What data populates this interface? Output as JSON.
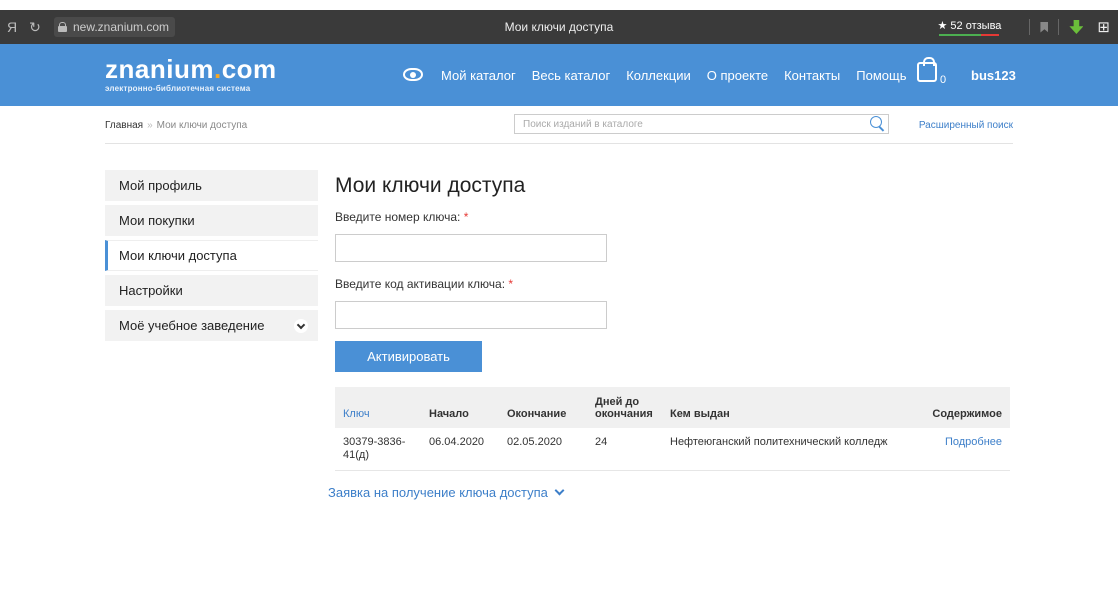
{
  "browser": {
    "yandex_glyph": "Я",
    "reload_glyph": "С",
    "url": "new.znanium.com",
    "tab_title": "Мои ключи доступа",
    "reviews_label": "★ 52 отзыва"
  },
  "header": {
    "logo_main_a": "znanium",
    "logo_dot": ".",
    "logo_main_b": "com",
    "logo_sub": "электронно-библиотечная система",
    "nav": [
      "Мой каталог",
      "Весь каталог",
      "Коллекции",
      "О проекте",
      "Контакты",
      "Помощь"
    ],
    "cart_count": "0",
    "username": "bus123"
  },
  "breadcrumb": {
    "home": "Главная",
    "separator": "»",
    "current": "Мои ключи доступа"
  },
  "search": {
    "placeholder": "Поиск изданий в каталоге",
    "advanced": "Расширенный поиск"
  },
  "sidebar": {
    "items": [
      {
        "label": "Мой профиль"
      },
      {
        "label": "Мои покупки"
      },
      {
        "label": "Мои ключи доступа"
      },
      {
        "label": "Настройки"
      },
      {
        "label": "Моё учебное заведение"
      }
    ]
  },
  "main": {
    "title": "Мои ключи доступа",
    "key_number_label": "Введите номер ключа:",
    "activation_code_label": "Введите код активации ключа:",
    "required_mark": "*",
    "activate_button": "Активировать",
    "table": {
      "headers": [
        "Ключ",
        "Начало",
        "Окончание",
        "Дней до окончания",
        "Кем выдан",
        "Содержимое"
      ],
      "rows": [
        {
          "key": "30379-3836-41(д)",
          "start": "06.04.2020",
          "end": "02.05.2020",
          "days_left": "24",
          "issuer": "Нефтеюганский политехнический колледж",
          "content_link": "Подробнее"
        }
      ]
    },
    "request_link": "Заявка на получение ключа доступа"
  },
  "colors": {
    "brand_blue": "#4a90d6",
    "link_blue": "#3d7fc9",
    "logo_dot": "#f5a623",
    "required": "#e53935"
  }
}
